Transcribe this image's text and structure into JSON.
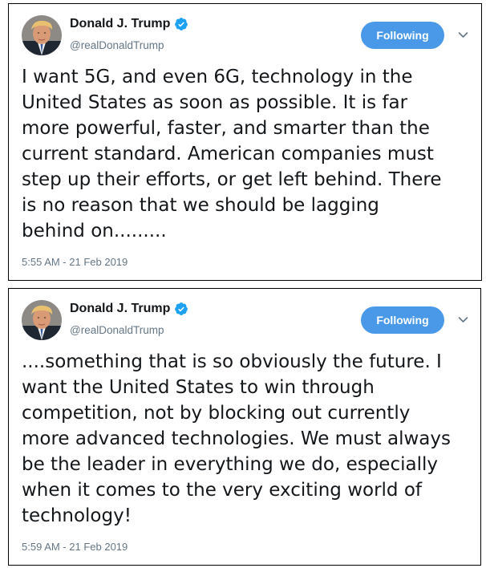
{
  "tweets": [
    {
      "author": {
        "name": "Donald J. Trump",
        "handle": "@realDonaldTrump",
        "verified": true
      },
      "follow_button_label": "Following",
      "text": "I want 5G, and even 6G, technology in the\nUnited States as soon as possible. It is far\nmore powerful, faster, and smarter than the\ncurrent standard. American companies must\nstep up their efforts, or get left behind. There\nis no reason that we should be lagging\nbehind on.........",
      "timestamp": "5:55 AM - 21 Feb 2019"
    },
    {
      "author": {
        "name": "Donald J. Trump",
        "handle": "@realDonaldTrump",
        "verified": true
      },
      "follow_button_label": "Following",
      "text": "....something that is so obviously the future. I\nwant the United States to win through\ncompetition, not by blocking out currently\nmore advanced technologies. We must always\nbe the leader in everything we do, especially\nwhen it comes to the very exciting world of\ntechnology!",
      "timestamp": "5:59 AM - 21 Feb 2019"
    }
  ],
  "colors": {
    "follow_button": "#4a99e9",
    "verified_badge": "#1da1f2",
    "secondary_text": "#657786",
    "primary_text": "#14171a"
  },
  "icons": {
    "avatar": "profile-photo",
    "verified": "verified-badge-icon",
    "menu": "chevron-down-icon"
  }
}
